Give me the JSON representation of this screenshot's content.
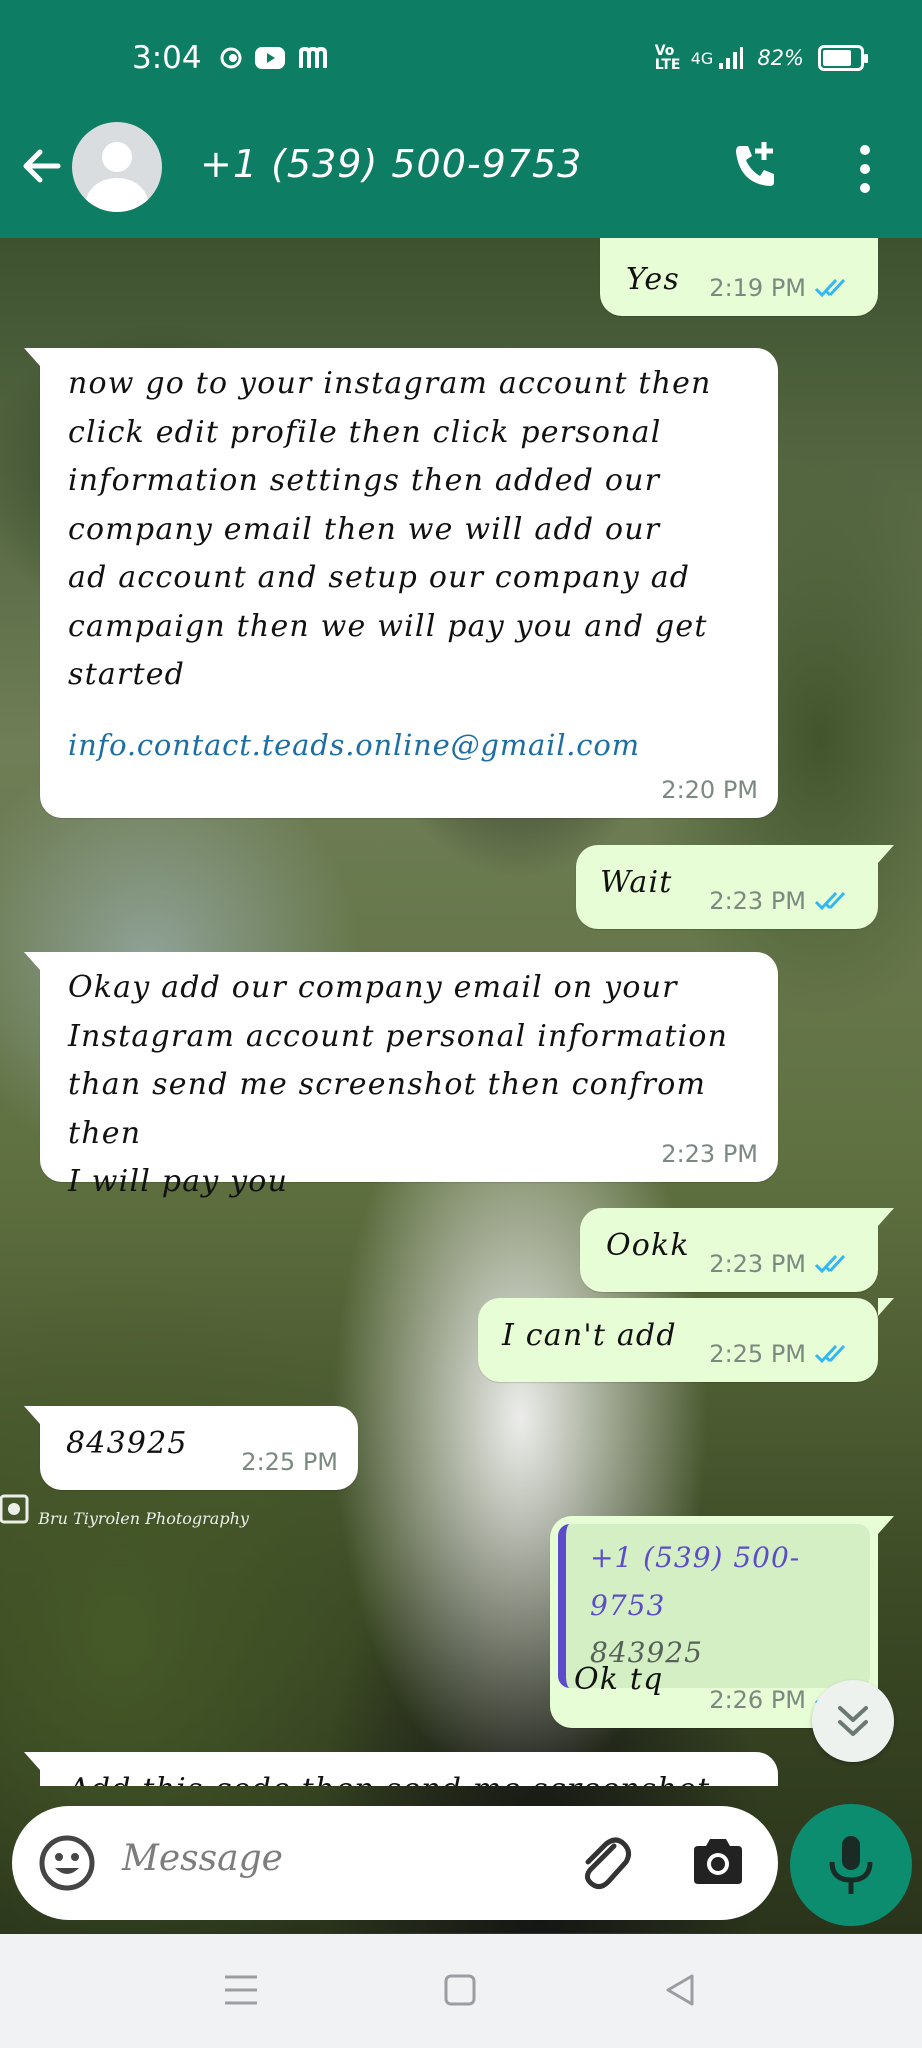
{
  "status_bar": {
    "time": "3:04",
    "network": "4G",
    "volte": "Vo LTE",
    "battery": "82%",
    "battery_level": 0.82
  },
  "header": {
    "contact_name": "+1 (539) 500-9753",
    "icons": [
      "back-arrow-icon",
      "avatar",
      "add-call-icon",
      "more-vertical-icon"
    ]
  },
  "wallpaper": {
    "watermark": "Bru Tiyrolen Photography"
  },
  "messages": [
    {
      "direction": "out",
      "text": "Yes",
      "time": "2:19 PM",
      "read": true
    },
    {
      "direction": "in",
      "text": "now go to your instagram account then\nclick edit profile then click personal\ninformation settings then added our\ncompany email then we will add our\nad account and setup our company ad\ncampaign then we will pay you and get\nstarted",
      "link": "info.contact.teads.online@gmail.com",
      "time": "2:20 PM"
    },
    {
      "direction": "out",
      "text": "Wait",
      "time": "2:23 PM",
      "read": true
    },
    {
      "direction": "in",
      "text": "Okay add our company email on your\nInstagram account personal information\nthan send me screenshot then confrom then\nI will pay you",
      "time": "2:23 PM"
    },
    {
      "direction": "out",
      "text": "Ookk",
      "time": "2:23 PM",
      "read": true
    },
    {
      "direction": "out",
      "text": "I can't add",
      "time": "2:25 PM",
      "read": true
    },
    {
      "direction": "in",
      "text": "843925",
      "time": "2:25 PM"
    },
    {
      "direction": "out",
      "quote_name": "+1 (539) 500-9753",
      "quote_text": "843925",
      "text": "Ok tq",
      "time": "2:26 PM",
      "read": true
    },
    {
      "direction": "in",
      "text": "Add this code then send me screenshot",
      "partial": true
    }
  ],
  "composer": {
    "placeholder": "Message"
  },
  "colors": {
    "brand": "#0d7d63",
    "outgoing_bubble": "#e7fdd6",
    "incoming_bubble": "#ffffff",
    "read_ticks": "#34b7f1",
    "link": "#1c6ea4",
    "quote_accent": "#5c4cc9",
    "mic_button": "#0c8d6f"
  }
}
